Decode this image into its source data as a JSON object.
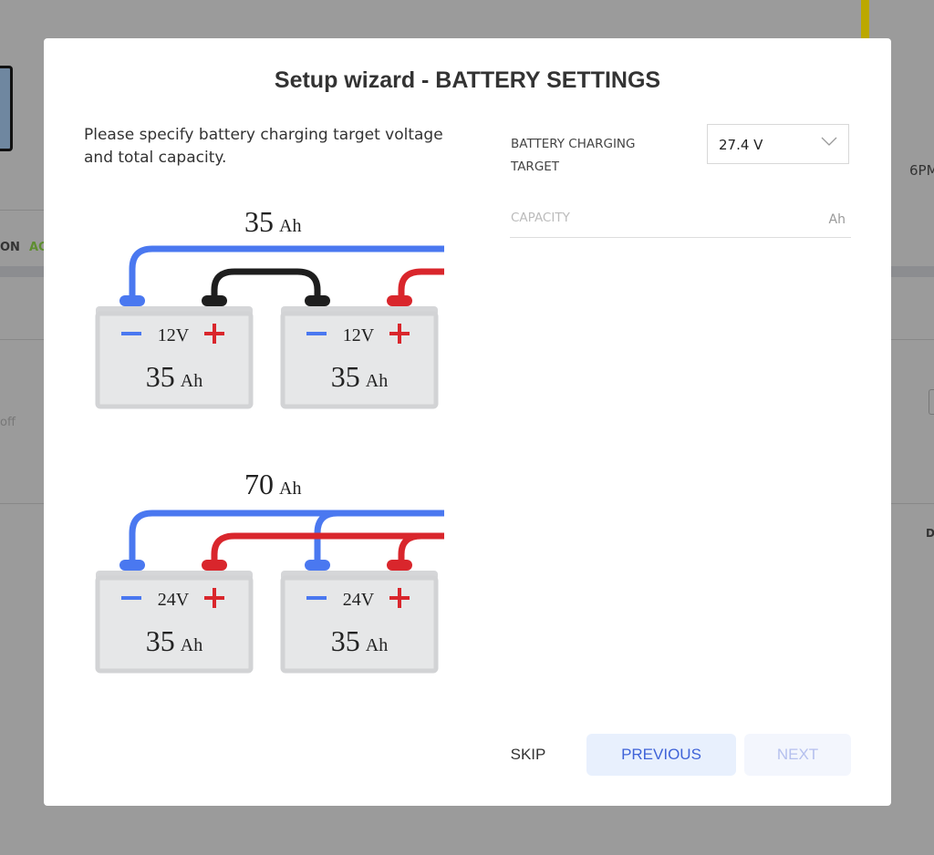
{
  "background": {
    "fragments": [
      "ON",
      "AC",
      "off",
      "6PM",
      "D"
    ],
    "accent_green": "#6a9a3a",
    "accent_yellow": "#c8b400"
  },
  "modal": {
    "title": "Setup wizard - BATTERY SETTINGS",
    "description": "Please specify battery charging target voltage and total capacity.",
    "charging_target": {
      "label": "BATTERY CHARGING TARGET",
      "value": "27.4 V",
      "icon": "chevron-down-icon"
    },
    "capacity": {
      "placeholder": "CAPACITY",
      "unit": "Ah",
      "value": ""
    },
    "diagram_series": {
      "total": "35",
      "unit": "Ah",
      "batteries": [
        {
          "voltage": "12V",
          "capacity": "35"
        },
        {
          "voltage": "12V",
          "capacity": "35"
        }
      ],
      "minus": "−",
      "plus": "+"
    },
    "diagram_parallel": {
      "total": "70",
      "unit": "Ah",
      "batteries": [
        {
          "voltage": "24V",
          "capacity": "35"
        },
        {
          "voltage": "24V",
          "capacity": "35"
        }
      ]
    },
    "buttons": {
      "skip": "SKIP",
      "previous": "PREVIOUS",
      "next": "NEXT"
    },
    "colors": {
      "wire_negative": "#4a78f0",
      "wire_positive": "#d9262c",
      "wire_link": "#1e1e1e",
      "battery": "#d5d6d8",
      "primary_button_bg": "#e8f0fd",
      "primary_button_text": "#3f63d8"
    }
  }
}
